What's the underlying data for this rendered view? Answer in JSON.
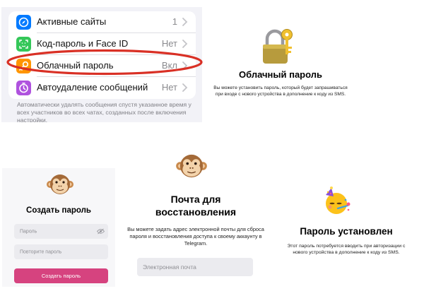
{
  "settings": {
    "rows": [
      {
        "label": "Активные сайты",
        "value": "1",
        "icon": "compass-icon",
        "color": "#007aff"
      },
      {
        "label": "Код-пароль и Face ID",
        "value": "Нет",
        "icon": "faceid-icon",
        "color": "#34c759"
      },
      {
        "label": "Облачный пароль",
        "value": "Вкл",
        "icon": "key-icon",
        "color": "#ff9500"
      },
      {
        "label": "Автоудаление сообщений",
        "value": "Нет",
        "icon": "timer-icon",
        "color": "#af52de"
      }
    ],
    "footer": "Автоматически удалять сообщения спустя указанное время у всех участников во всех чатах, созданных после включения настройки.",
    "highlight_color": "#d93025"
  },
  "cloud_intro": {
    "title": "Облачный пароль",
    "description": "Вы можете установить пароль, который будет запрашиваться при входе с нового устройства в дополнение к коду из SMS."
  },
  "create_password": {
    "title": "Создать пароль",
    "password_placeholder": "Пароль",
    "repeat_placeholder": "Повторите пароль",
    "button": "Создать пароль",
    "button_color": "#d6437f"
  },
  "recovery": {
    "title_line1": "Почта для",
    "title_line2": "восстановления",
    "description": "Вы можете задать адрес электронной почты для сброса пароля и восстановления доступа к своему аккаунту в Telegram.",
    "email_placeholder": "Электронная почта"
  },
  "done": {
    "title": "Пароль установлен",
    "description": "Этот пароль потребуется вводить при авторизации с нового устройства в дополнение к коду из SMS."
  }
}
